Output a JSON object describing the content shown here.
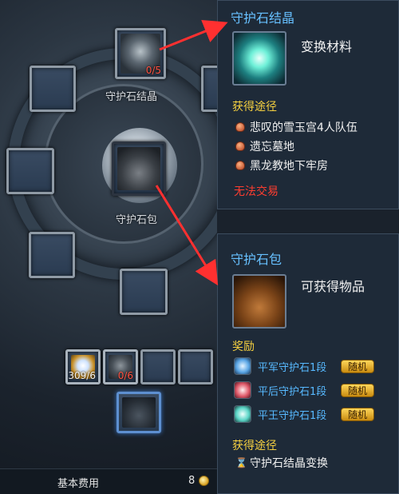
{
  "board": {
    "crystal_slot": {
      "count": "0/5",
      "label": "守护石结晶"
    },
    "bag_slot": {
      "label": "守护石包"
    },
    "ingredient_slots": [
      {
        "count": "309/6",
        "count_color": "#f2f2f2"
      },
      {
        "count": "0/6",
        "count_color": "#ff5040"
      }
    ],
    "fee": {
      "label": "基本费用",
      "value": "8",
      "icon": "gold-coin-icon"
    }
  },
  "tooltip_crystal": {
    "title": "守护石结晶",
    "kind": "变换材料",
    "source_header": "获得途径",
    "sources": [
      "悲叹的雪玉宫4人队伍",
      "遗忘墓地",
      "黑龙教地下牢房"
    ],
    "untradable": "无法交易"
  },
  "tooltip_bag": {
    "title": "守护石包",
    "kind": "可获得物品",
    "reward_header": "奖励",
    "rewards": [
      {
        "name": "平军守护石1段",
        "badge": "随机",
        "icon": "blue-gem-icon"
      },
      {
        "name": "平后守护石1段",
        "badge": "随机",
        "icon": "red-gem-icon"
      },
      {
        "name": "平王守护石1段",
        "badge": "随机",
        "icon": "teal-gem-icon"
      }
    ],
    "source_header": "获得途径",
    "sources": [
      "守护石结晶变换"
    ]
  },
  "colors": {
    "title": "#67c0ff",
    "section": "#f5d040",
    "untradable": "#ff3d30",
    "reward": "#57b9ff",
    "arrow": "#ff3030"
  }
}
